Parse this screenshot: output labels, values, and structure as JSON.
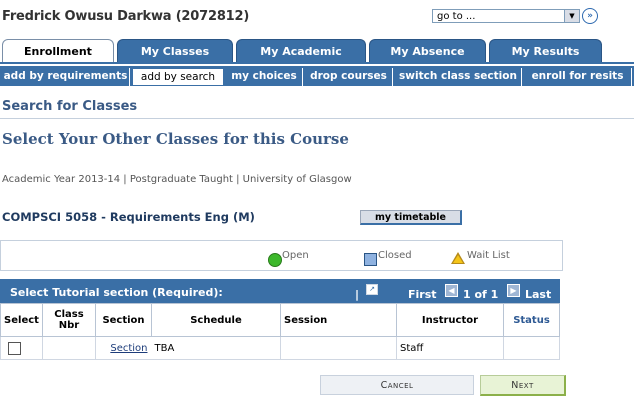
{
  "header": {
    "student_name": "Fredrick Owusu Darkwa (2072812)",
    "goto_value": "go to ..."
  },
  "tabs": [
    {
      "label": "Enrollment",
      "active": true
    },
    {
      "label": "My Classes",
      "active": false
    },
    {
      "label": "My Academic Record",
      "active": false
    },
    {
      "label": "My Absence",
      "active": false
    },
    {
      "label": "My Results",
      "active": false
    }
  ],
  "subtabs": [
    {
      "label": "add by requirements",
      "active": false
    },
    {
      "label": "add by search",
      "active": true
    },
    {
      "label": "my choices",
      "active": false
    },
    {
      "label": "drop courses",
      "active": false
    },
    {
      "label": "switch class section",
      "active": false
    },
    {
      "label": "enroll for resits",
      "active": false
    }
  ],
  "page": {
    "title": "Search for Classes",
    "section_heading": "Select Your Other Classes for this Course",
    "context_line": "Academic Year 2013-14 | Postgraduate Taught | University of Glasgow",
    "course_title": "COMPSCI 5058 - Requirements Eng (M)",
    "timetable_button": "my timetable"
  },
  "legend": {
    "open": "Open",
    "closed": "Closed",
    "wait_list": "Wait List",
    "colors": {
      "open": "#3db82b",
      "closed": "#8fb2e0",
      "wait_list": "#f5c518"
    }
  },
  "grid": {
    "title": "Select Tutorial section (Required):",
    "first": "First",
    "page_count": "1 of 1",
    "last": "Last",
    "columns": [
      "Select",
      "Class Nbr",
      "Section",
      "Schedule",
      "Session",
      "Instructor",
      "Status"
    ],
    "rows": [
      {
        "select": false,
        "class_nbr": "",
        "section": "Section",
        "schedule": "TBA",
        "session": "",
        "instructor": "Staff",
        "status": ""
      }
    ]
  },
  "actions": {
    "cancel": "Cancel",
    "next": "Next"
  },
  "colors": {
    "accent": "#3a6fa6",
    "heading": "#3a5a85"
  }
}
